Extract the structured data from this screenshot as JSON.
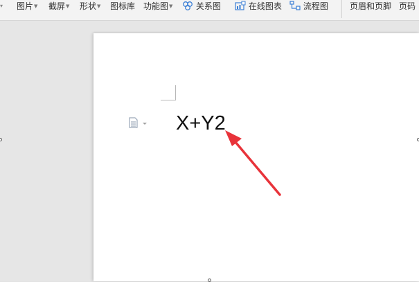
{
  "toolbar": {
    "items": [
      {
        "label": "图片",
        "has_dropdown": true
      },
      {
        "label": "截屏",
        "has_dropdown": true
      },
      {
        "label": "形状",
        "has_dropdown": true
      },
      {
        "label": "图标库",
        "has_dropdown": false
      },
      {
        "label": "功能图",
        "has_dropdown": true
      },
      {
        "label": "关系图",
        "icon": "relation-chart-icon"
      },
      {
        "label": "在线图表",
        "icon": "online-chart-icon"
      },
      {
        "label": "流程图",
        "icon": "flowchart-icon"
      },
      {
        "label": "页眉和页脚"
      },
      {
        "label": "页码"
      }
    ]
  },
  "document": {
    "text": "X+Y2"
  },
  "colors": {
    "arrow": "#e8333a",
    "icon_blue": "#3b7fd6"
  }
}
